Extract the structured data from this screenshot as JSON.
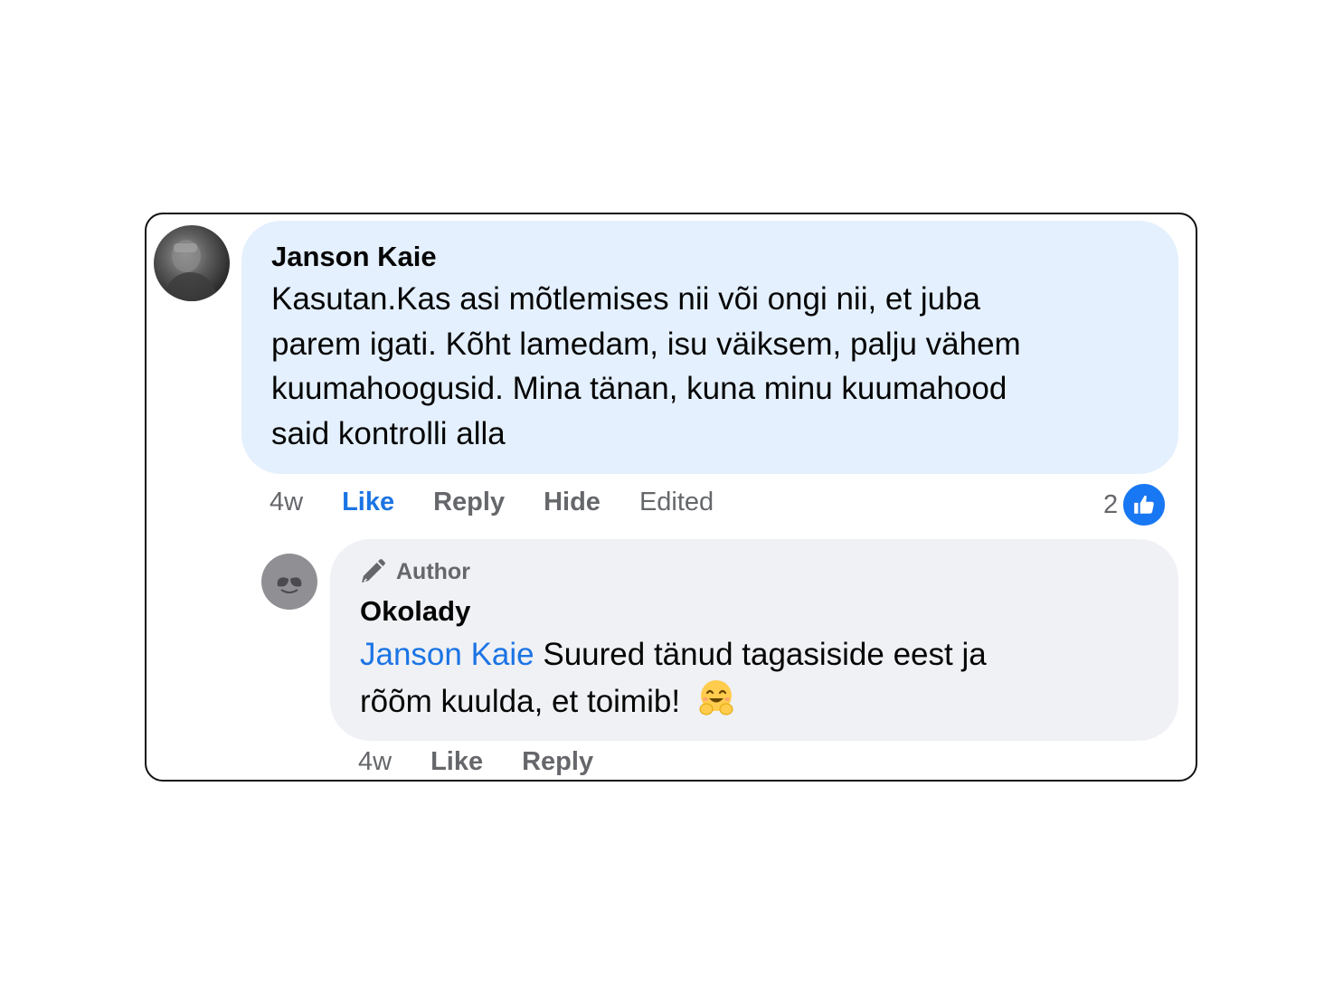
{
  "comment": {
    "author": "Janson Kaie",
    "text": "Kasutan.Kas asi mõtlemises nii või ongi nii, et juba\nparem igati. Kõht lamedam, isu väiksem, palju vähem\nkuumahoogusid. Mina tänan, kuna minu kuumahood\nsaid kontrolli alla",
    "time": "4w",
    "like_label": "Like",
    "reply_label": "Reply",
    "hide_label": "Hide",
    "edited_label": "Edited",
    "reaction_count": "2",
    "reaction_icon": "thumbs-up-icon",
    "accent_color": "#1b74e4",
    "bubble_color": "#e4f0fd"
  },
  "reply": {
    "badge": "Author",
    "badge_icon": "pen-icon",
    "author": "Okolady",
    "mention": "Janson Kaie",
    "text": " Suured tänud tagasiside eest ja\nrõõm kuulda, et toimib! ",
    "emoji": "smiling-face-with-open-hands-emoji",
    "time": "4w",
    "like_label": "Like",
    "reply_label": "Reply",
    "bubble_color": "#f0f1f5"
  }
}
